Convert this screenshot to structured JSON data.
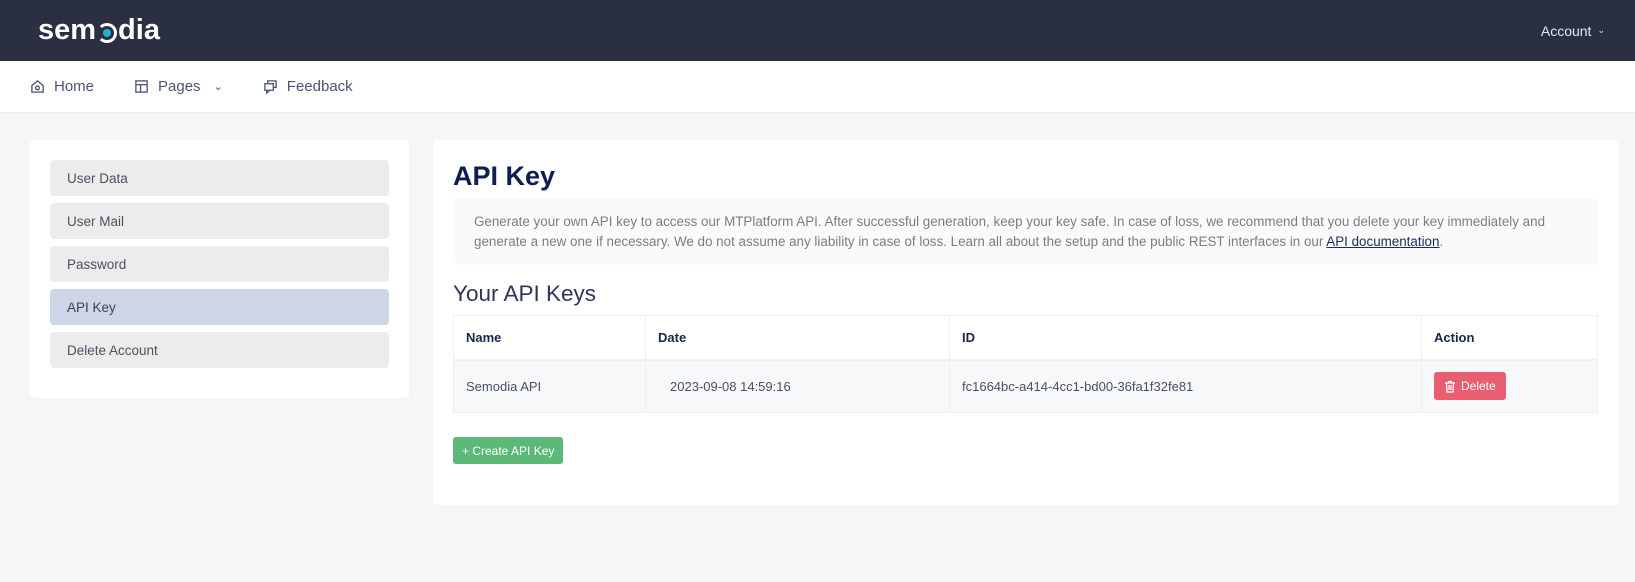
{
  "header": {
    "logo_text_left": "sem",
    "logo_text_right": "dia",
    "account_label": "Account"
  },
  "nav": {
    "items": [
      {
        "label": "Home",
        "icon": "home-icon"
      },
      {
        "label": "Pages",
        "icon": "layout-icon",
        "has_dropdown": true
      },
      {
        "label": "Feedback",
        "icon": "chat-icon"
      }
    ]
  },
  "sidebar": {
    "items": [
      {
        "label": "User Data",
        "active": false
      },
      {
        "label": "User Mail",
        "active": false
      },
      {
        "label": "Password",
        "active": false
      },
      {
        "label": "API Key",
        "active": true
      },
      {
        "label": "Delete Account",
        "active": false
      }
    ]
  },
  "main": {
    "title": "API Key",
    "info_text": "Generate your own API key to access our MTPlatform API. After successful generation, keep your key safe. In case of loss, we recommend that you delete your key immediately and generate a new one if necessary. We do not assume any liability in case of loss. Learn all about the setup and the public REST interfaces in our ",
    "info_link": "API documentation",
    "info_end": ".",
    "keys_heading": "Your API Keys",
    "table": {
      "columns": [
        "Name",
        "Date",
        "ID",
        "Action"
      ],
      "rows": [
        {
          "name": "Semodia API",
          "date": "2023-09-08 14:59:16",
          "id": "fc1664bc-a414-4cc1-bd00-36fa1f32fe81",
          "action": "Delete"
        }
      ]
    },
    "create_button": "+ Create API Key"
  },
  "colors": {
    "topbar": "#2a2f42",
    "accent_logo": "#1fb5c9",
    "delete": "#e95d70",
    "create": "#5cb878",
    "active_sidebar": "#cdd6e6"
  }
}
